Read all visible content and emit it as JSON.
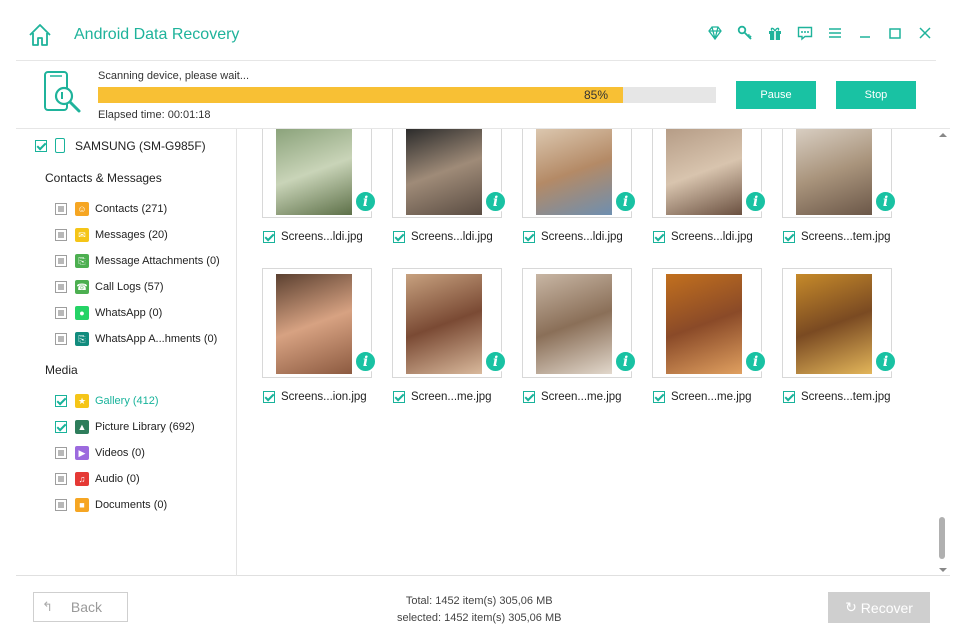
{
  "app": {
    "title": "Android Data Recovery",
    "accent": "#19c2a3",
    "toolbar_icons": [
      "diamond-icon",
      "key-icon",
      "gift-icon",
      "feedback-icon",
      "menu-icon",
      "minimize-icon",
      "maximize-icon",
      "close-icon"
    ]
  },
  "scan": {
    "status": "Scanning device, please wait...",
    "progress_percent": 85,
    "progress_text": "85%",
    "elapsed": "Elapsed time: 00:01:18",
    "pause_label": "Pause",
    "stop_label": "Stop",
    "progress_color": "#f8c034"
  },
  "sidebar": {
    "device": "SAMSUNG (SM-G985F)",
    "sections": [
      {
        "title": "Contacts & Messages",
        "items": [
          {
            "label": "Contacts (271)",
            "icon": "contacts-icon",
            "color": "#f6a623",
            "checked": false
          },
          {
            "label": "Messages (20)",
            "icon": "messages-icon",
            "color": "#f5c518",
            "checked": false
          },
          {
            "label": "Message Attachments (0)",
            "icon": "attachment-icon",
            "color": "#4caf50",
            "checked": false
          },
          {
            "label": "Call Logs (57)",
            "icon": "phone-icon",
            "color": "#4caf50",
            "checked": false
          },
          {
            "label": "WhatsApp (0)",
            "icon": "whatsapp-icon",
            "color": "#25d366",
            "checked": false
          },
          {
            "label": "WhatsApp A...hments (0)",
            "icon": "whatsapp-attachment-icon",
            "color": "#128c7e",
            "checked": false
          }
        ]
      },
      {
        "title": "Media",
        "items": [
          {
            "label": "Gallery (412)",
            "icon": "star-icon",
            "color": "#f5c518",
            "checked": true,
            "active": true
          },
          {
            "label": "Picture Library (692)",
            "icon": "picture-icon",
            "color": "#2e7d5b",
            "checked": true
          },
          {
            "label": "Videos (0)",
            "icon": "video-icon",
            "color": "#9c6ade",
            "checked": false
          },
          {
            "label": "Audio (0)",
            "icon": "music-icon",
            "color": "#e53935",
            "checked": false
          },
          {
            "label": "Documents (0)",
            "icon": "folder-icon",
            "color": "#f6a623",
            "checked": false
          }
        ]
      }
    ]
  },
  "gallery": {
    "files": [
      {
        "name": "Screens...ldi.jpg",
        "checked": true,
        "palette": [
          "#8aa27a",
          "#c9d4b8",
          "#5d7048"
        ]
      },
      {
        "name": "Screens...ldi.jpg",
        "checked": true,
        "palette": [
          "#2a2a2a",
          "#9f8b78",
          "#5a4c42"
        ]
      },
      {
        "name": "Screens...ldi.jpg",
        "checked": true,
        "palette": [
          "#dcc8b0",
          "#b48a66",
          "#6e8fb0"
        ]
      },
      {
        "name": "Screens...ldi.jpg",
        "checked": true,
        "palette": [
          "#b59c86",
          "#d8c4ae",
          "#6a5040"
        ]
      },
      {
        "name": "Screens...tem.jpg",
        "checked": true,
        "palette": [
          "#d9cfc3",
          "#a9947c",
          "#6b5748"
        ]
      },
      {
        "name": "Screens...ion.jpg",
        "checked": true,
        "palette": [
          "#5b4030",
          "#d7a282",
          "#8c5a40"
        ]
      },
      {
        "name": "Screen...me.jpg",
        "checked": true,
        "palette": [
          "#c7a17f",
          "#7a4a34",
          "#d9b99c"
        ]
      },
      {
        "name": "Screen...me.jpg",
        "checked": true,
        "palette": [
          "#c8b6a4",
          "#8a6f58",
          "#e2d8cc"
        ]
      },
      {
        "name": "Screen...me.jpg",
        "checked": true,
        "palette": [
          "#c2701e",
          "#8a4a28",
          "#e0a060"
        ]
      },
      {
        "name": "Screens...tem.jpg",
        "checked": true,
        "palette": [
          "#c68a2a",
          "#7a4a22",
          "#e3b65a"
        ]
      }
    ]
  },
  "footer": {
    "back_label": "Back",
    "total": "Total: 1452 item(s) 305,06 MB",
    "selected": "selected: 1452 item(s) 305,06 MB",
    "recover_label": "Recover"
  }
}
